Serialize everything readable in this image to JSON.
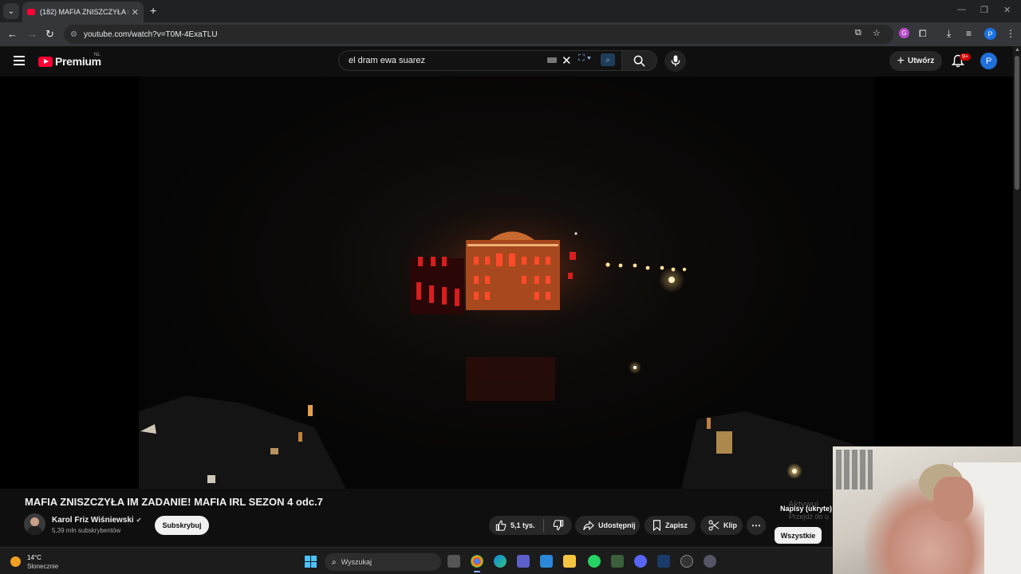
{
  "browser": {
    "tab_title": "(182) MAFIA ZNISZCZYŁA IM ZA",
    "url": "youtube.com/watch?v=T0M-4ExaTLU"
  },
  "header": {
    "logo_text": "Premium",
    "logo_region": "NL",
    "search_value": "el dram ewa suarez",
    "create_label": "Utwórz",
    "notifications_badge": "9+",
    "avatar_letter": "P"
  },
  "video": {
    "title": "MAFIA ZNISZCZYŁA IM ZADANIE! MAFIA IRL SEZON 4 odc.7",
    "channel_name": "Karol Friz Wiśniewski",
    "subscribers": "5,39 mln subskrybentów",
    "subscribe_label": "Subskrybuj",
    "likes": "5,1 tys.",
    "share_label": "Udostępnij",
    "save_label": "Zapisz",
    "clip_label": "Klip",
    "more_label": "⋯"
  },
  "side": {
    "captions_text": "Napisy (ukryte)",
    "activate_line1": "Aktywuj",
    "activate_line2": "Przejdź do u",
    "chip_all": "Wszystkie"
  },
  "taskbar": {
    "temperature": "14°C",
    "condition": "Słonecznie",
    "search_placeholder": "Wyszukaj"
  },
  "colors": {
    "youtube_red": "#ff0033",
    "accent_blue": "#1e6fd9"
  }
}
